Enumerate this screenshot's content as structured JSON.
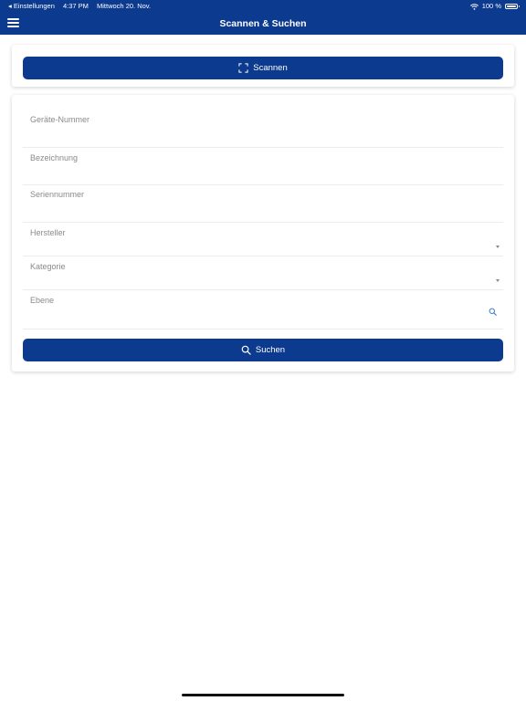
{
  "status_bar": {
    "back_app": "◂ Einstellungen",
    "time": "4:37 PM",
    "date": "Mittwoch 20. Nov.",
    "battery": "100 %",
    "battery_level": 1.0
  },
  "header": {
    "title": "Scannen & Suchen"
  },
  "scan": {
    "button_label": "Scannen"
  },
  "search_form": {
    "fields": [
      {
        "label": "Geräte-Nummer",
        "value": ""
      },
      {
        "label": "Bezeichnung",
        "value": ""
      },
      {
        "label": "Seriennummer",
        "value": ""
      },
      {
        "label": "Hersteller",
        "value": "",
        "type": "dropdown"
      },
      {
        "label": "Kategorie",
        "value": "",
        "type": "dropdown"
      },
      {
        "label": "Ebene",
        "value": "",
        "type": "search"
      }
    ],
    "search_button_label": "Suchen"
  },
  "colors": {
    "primary": "#0b3a8e",
    "accent_icon": "#3a78c9",
    "label_gray": "#8a8a8a",
    "divider": "#ececec"
  },
  "icons": {
    "menu": "hamburger-menu-icon",
    "scan": "scan-frame-icon",
    "search": "magnifier-icon",
    "wifi": "wifi-icon",
    "battery": "battery-icon"
  }
}
